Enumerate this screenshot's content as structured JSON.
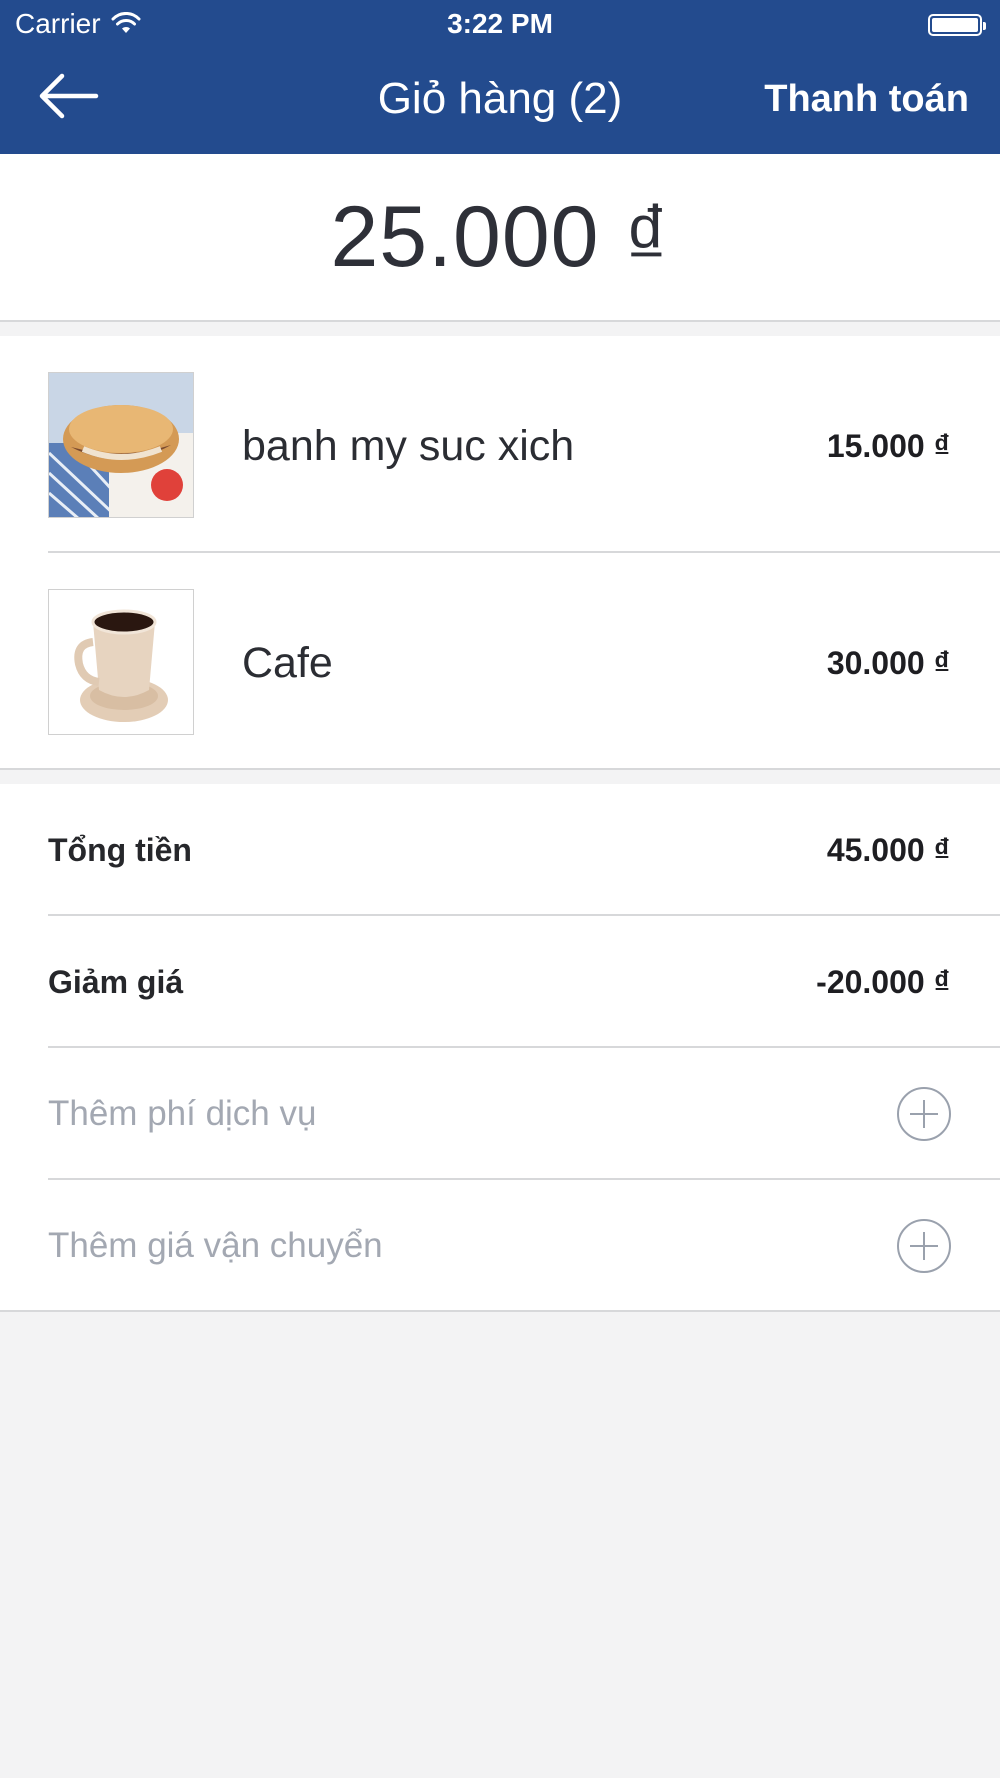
{
  "status_bar": {
    "carrier": "Carrier",
    "time": "3:22 PM"
  },
  "nav": {
    "title": "Giỏ hàng (2)",
    "action_label": "Thanh toán",
    "back_icon": "arrow-left-icon"
  },
  "cart_total": "25.000 ₫",
  "items": [
    {
      "name": "banh my suc xich",
      "price": "15.000 ₫",
      "image": "banh-mi-thumbnail"
    },
    {
      "name": "Cafe",
      "price": "30.000 ₫",
      "image": "coffee-cup-thumbnail"
    }
  ],
  "summary": {
    "subtotal_label": "Tổng tiền",
    "subtotal_value": "45.000 ₫",
    "discount_label": "Giảm giá",
    "discount_value": "-20.000 ₫",
    "add_service_fee_label": "Thêm phí dịch vụ",
    "add_shipping_label": "Thêm giá vận chuyển"
  },
  "colors": {
    "header": "#234b8e",
    "background": "#f3f3f4",
    "divider": "#d7d8da",
    "muted_text": "#a3a8b2"
  }
}
